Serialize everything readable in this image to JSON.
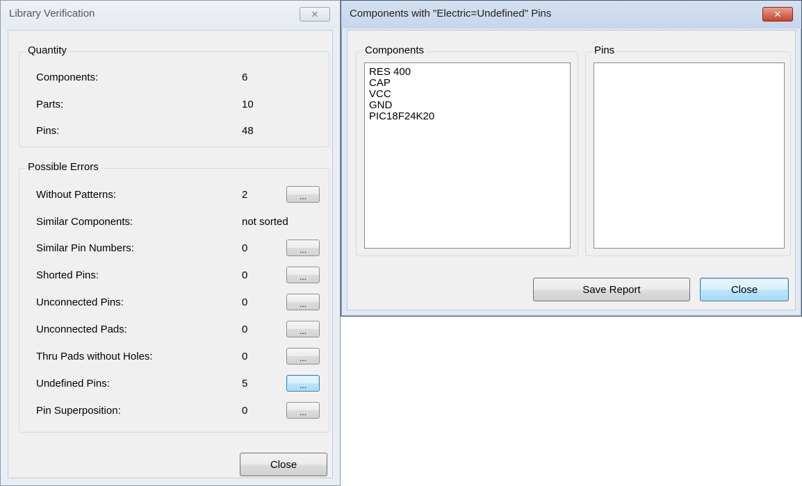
{
  "library_window": {
    "title": "Library Verification",
    "close_glyph": "✕",
    "quantity": {
      "legend": "Quantity",
      "rows": [
        {
          "label": "Components:",
          "value": "6"
        },
        {
          "label": "Parts:",
          "value": "10"
        },
        {
          "label": "Pins:",
          "value": "48"
        }
      ]
    },
    "possible_errors": {
      "legend": "Possible Errors",
      "rows": [
        {
          "label": "Without Patterns:",
          "value": "2",
          "button": "..."
        },
        {
          "label": "Similar Components:",
          "value": "not sorted"
        },
        {
          "label": "Similar Pin Numbers:",
          "value": "0",
          "button": "..."
        },
        {
          "label": "Shorted Pins:",
          "value": "0",
          "button": "..."
        },
        {
          "label": "Unconnected Pins:",
          "value": "0",
          "button": "..."
        },
        {
          "label": "Unconnected Pads:",
          "value": "0",
          "button": "..."
        },
        {
          "label": "Thru Pads without Holes:",
          "value": "0",
          "button": "..."
        },
        {
          "label": "Undefined Pins:",
          "value": "5",
          "button": "..."
        },
        {
          "label": "Pin Superposition:",
          "value": "0",
          "button": "..."
        }
      ]
    },
    "close_label": "Close"
  },
  "pins_window": {
    "title": "Components with \"Electric=Undefined\" Pins",
    "close_glyph": "✕",
    "components_group": {
      "legend": "Components",
      "items": [
        "RES 400",
        "CAP",
        "VCC",
        "GND",
        "PIC18F24K20"
      ]
    },
    "pins_group": {
      "legend": "Pins",
      "items": []
    },
    "save_report_label": "Save Report",
    "close_label": "Close"
  }
}
